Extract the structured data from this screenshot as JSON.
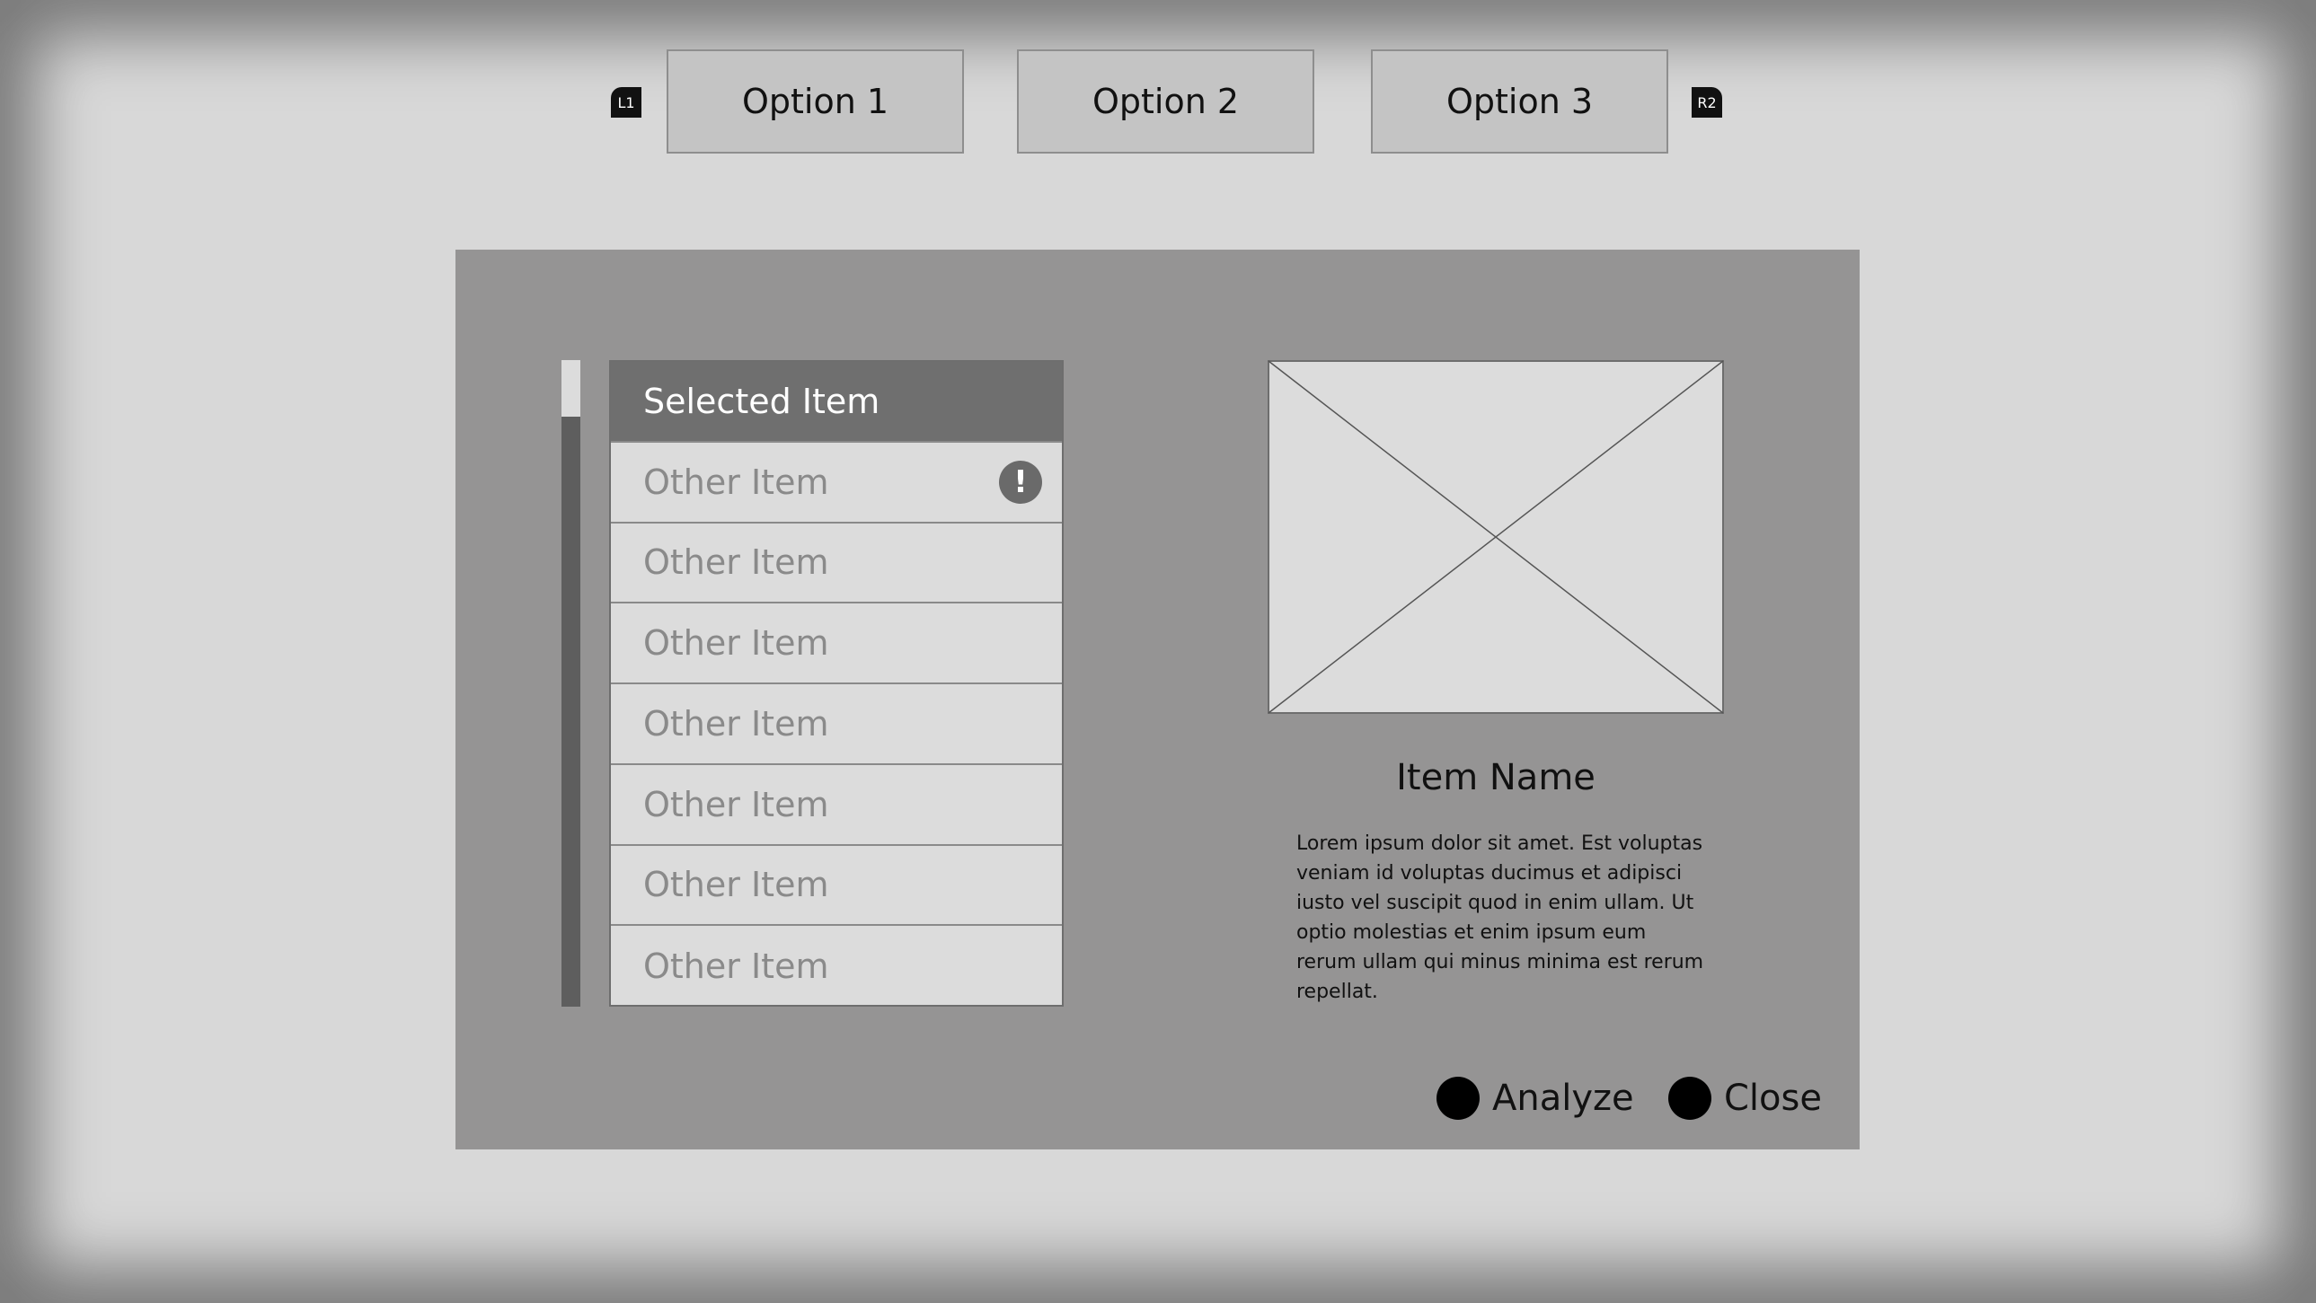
{
  "tabs": {
    "left_shoulder": "L1",
    "right_shoulder": "R2",
    "items": [
      {
        "label": "Option 1"
      },
      {
        "label": "Option 2"
      },
      {
        "label": "Option 3"
      }
    ]
  },
  "list": {
    "items": [
      {
        "label": "Selected Item",
        "selected": true
      },
      {
        "label": "Other Item",
        "alert": true
      },
      {
        "label": "Other Item"
      },
      {
        "label": "Other Item"
      },
      {
        "label": "Other Item"
      },
      {
        "label": "Other Item"
      },
      {
        "label": "Other Item"
      },
      {
        "label": "Other Item"
      }
    ],
    "alert_glyph": "!"
  },
  "detail": {
    "image_icon": "image-placeholder-icon",
    "name": "Item Name",
    "description": "Lorem ipsum dolor sit amet. Est voluptas veniam id voluptas ducimus et adipisci iusto vel suscipit quod in enim ullam. Ut optio molestias et enim ipsum eum rerum ullam qui minus minima est rerum repellat."
  },
  "actions": {
    "analyze_label": "Analyze",
    "close_label": "Close"
  },
  "colors": {
    "panel": "#959494",
    "selected_row": "#6f6f6f",
    "background": "#d8d8d8"
  }
}
